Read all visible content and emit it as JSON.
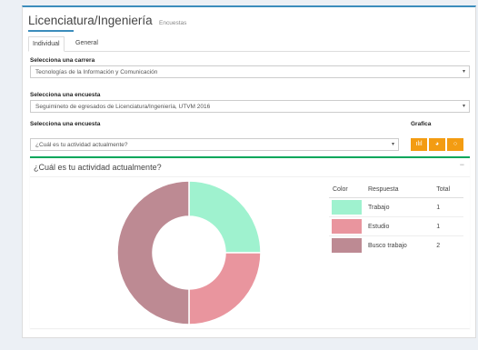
{
  "header": {
    "title": "Licenciatura/Ingeniería",
    "subtitle": "Encuestas"
  },
  "tabs": [
    {
      "label": "Individual",
      "active": true
    },
    {
      "label": "General",
      "active": false
    }
  ],
  "form": {
    "carrera_label": "Selecciona una carrera",
    "carrera_value": "Tecnologías de la Información y Comunicación",
    "encuesta_label": "Selecciona una encuesta",
    "encuesta_value": "Seguimineto de egresados de Licenciatura/Ingeniería, UTVM 2016",
    "pregunta_label": "Selecciona una encuesta",
    "pregunta_value": "¿Cuál es tu actividad actualmente?",
    "grafica_label": "Grafica"
  },
  "chart_buttons": [
    {
      "icon": "bar-chart-icon",
      "glyph": "ılıl"
    },
    {
      "icon": "pie-chart-icon",
      "glyph": "◕"
    },
    {
      "icon": "donut-chart-icon",
      "glyph": "○"
    }
  ],
  "panel": {
    "title": "¿Cuál es tu actividad actualmente?",
    "collapse": "−"
  },
  "legend": {
    "headers": [
      "Color",
      "Respuesta",
      "Total"
    ],
    "rows": [
      {
        "respuesta": "Trabajo",
        "total": "1"
      },
      {
        "respuesta": "Estudio",
        "total": "1"
      },
      {
        "respuesta": "Busco trabajo",
        "total": "2"
      }
    ]
  },
  "colors": {
    "accent": "#3c8dbc",
    "panel_border": "#00a65a",
    "button": "#f39c12"
  },
  "chart_data": {
    "type": "pie",
    "variant": "donut",
    "title": "¿Cuál es tu actividad actualmente?",
    "categories": [
      "Trabajo",
      "Estudio",
      "Busco trabajo"
    ],
    "values": [
      1,
      1,
      2
    ],
    "colors": [
      "#9ff2cf",
      "#e9959e",
      "#bd8a93"
    ]
  }
}
